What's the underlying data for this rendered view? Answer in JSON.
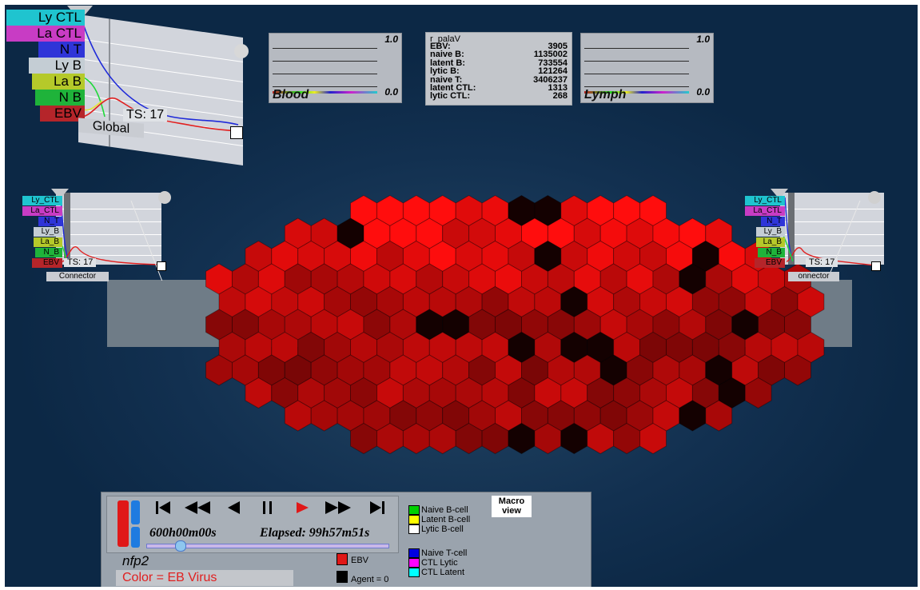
{
  "global_panel": {
    "legend": [
      "Ly CTL",
      "La CTL",
      "N T",
      "Ly B",
      "La B",
      "N B",
      "EBV"
    ],
    "legend_colors": [
      "#1fc4cf",
      "#c83cc4",
      "#2f35d8",
      "#c4cdd4",
      "#b5c92a",
      "#1fb33a",
      "#b5252a"
    ],
    "ts_label": "TS: 17",
    "name": "Global"
  },
  "blood_panel": {
    "title": "Blood",
    "max_label": "1.0",
    "min_label": "0.0"
  },
  "lymph_panel": {
    "title": "Lymph",
    "max_label": "1.0",
    "min_label": "0.0"
  },
  "stats": {
    "title": "r_palaV",
    "rows": [
      {
        "label": "EBV:",
        "value": "3905"
      },
      {
        "label": "naive B:",
        "value": "1135002"
      },
      {
        "label": "latent B:",
        "value": "733554"
      },
      {
        "label": "lytic B:",
        "value": "121264"
      },
      {
        "label": "naive T:",
        "value": "3406237"
      },
      {
        "label": "latent CTL:",
        "value": "1313"
      },
      {
        "label": "lytic CTL:",
        "value": "268"
      }
    ]
  },
  "left_connector": {
    "legend": [
      "Ly_CTL",
      "La_CTL",
      "N_T",
      "Ly_B",
      "La_B",
      "N_B",
      "EBV"
    ],
    "ts_label": "TS: 17",
    "name": "Connector"
  },
  "right_connector": {
    "legend": [
      "Ly_CTL",
      "La_CTL",
      "N_T",
      "Ly_B",
      "La_B",
      "N_B",
      "EBV"
    ],
    "ts_label": "TS: 17",
    "name": "onnector"
  },
  "controls": {
    "buttons": [
      "⏮",
      "⏪",
      "◀",
      "⏸",
      "▶",
      "⏩",
      "⏭"
    ],
    "time_label": "600h00m00s",
    "elapsed_label": "Elapsed: 99h57m51s",
    "slider_value": 0.14,
    "model_name": "nfp2",
    "color_mode": "Color = EB Virus",
    "macro_view": "Macro view"
  },
  "legend_colors_bottom": {
    "b_cells": [
      {
        "label": "Naive B-cell",
        "color": "#00d000"
      },
      {
        "label": "Latent B-cell",
        "color": "#ffff00"
      },
      {
        "label": "Lytic B-cell",
        "color": "#ffffff"
      }
    ],
    "t_cells": [
      {
        "label": "Naive T-cell",
        "color": "#0000e0"
      },
      {
        "label": "CTL Lytic",
        "color": "#ff00ff"
      },
      {
        "label": "CTL Latent",
        "color": "#00ffff"
      }
    ],
    "ebv_label": "EBV",
    "agent_label": "Agent = 0"
  },
  "colors": {
    "background": "#123050",
    "hex_bright": "#ff1010",
    "hex_dark": "#1a0000"
  }
}
